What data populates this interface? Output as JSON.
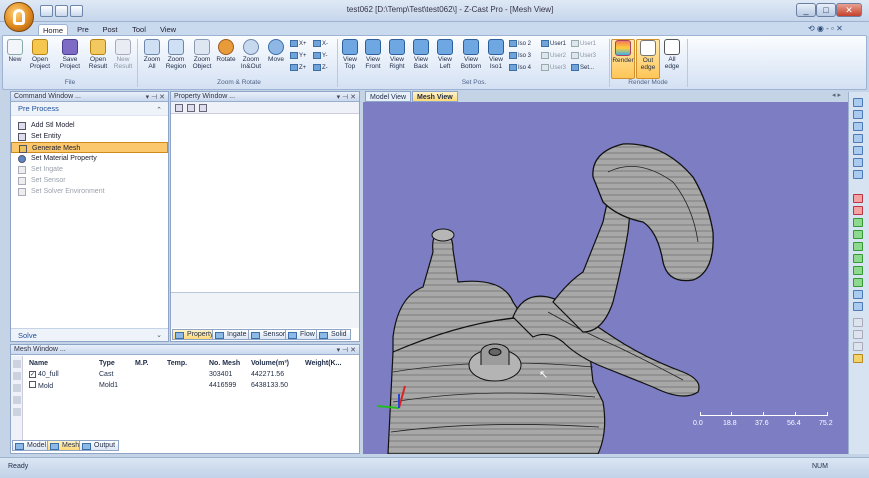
{
  "window": {
    "title": "test062 [D:\\Temp\\Test\\test062\\] - Z-Cast Pro - [Mesh View]",
    "controls": [
      "_",
      "□",
      "✕"
    ]
  },
  "ribbon": {
    "tabs": [
      "Home",
      "Pre",
      "Post",
      "Tool",
      "View"
    ],
    "active_tab": "Home",
    "file_buttons": [
      {
        "label1": "New",
        "label2": "",
        "icon": "new-document-icon"
      },
      {
        "label1": "Open",
        "label2": "Project",
        "icon": "open-folder-icon"
      },
      {
        "label1": "Save",
        "label2": "Project",
        "icon": "save-icon"
      },
      {
        "label1": "Open",
        "label2": "Result",
        "icon": "open-result-icon"
      },
      {
        "label1": "New",
        "label2": "Result",
        "icon": "new-result-icon"
      }
    ],
    "file_group": "File",
    "zoom_buttons": [
      {
        "label1": "Zoom",
        "label2": "All"
      },
      {
        "label1": "Zoom",
        "label2": "Region"
      },
      {
        "label1": "Zoom",
        "label2": "Object"
      },
      {
        "label1": "Rotate",
        "label2": ""
      },
      {
        "label1": "Zoom",
        "label2": "In&Out"
      },
      {
        "label1": "Move",
        "label2": ""
      }
    ],
    "rotate_small": [
      "X+",
      "X-",
      "Y+",
      "Y-",
      "Z+",
      "Z-"
    ],
    "zoom_group": "Zoom & Rotate",
    "view_buttons": [
      {
        "label1": "View",
        "label2": "Top"
      },
      {
        "label1": "View",
        "label2": "Front"
      },
      {
        "label1": "View",
        "label2": "Right"
      },
      {
        "label1": "View",
        "label2": "Back"
      },
      {
        "label1": "View",
        "label2": "Left"
      },
      {
        "label1": "View",
        "label2": "Bottom"
      },
      {
        "label1": "View",
        "label2": "Iso1"
      }
    ],
    "iso_small": [
      "Iso 2",
      "User1",
      "User1",
      "Iso 3",
      "User2",
      "User3",
      "Iso 4",
      "User3",
      "Set..."
    ],
    "setpos_group": "Set Pos.",
    "render_buttons": [
      {
        "label1": "Render",
        "label2": ""
      },
      {
        "label1": "Out",
        "label2": "edge"
      },
      {
        "label1": "All",
        "label2": "edge"
      }
    ],
    "render_group": "Render Mode",
    "right_icons": "⟲ ◉ - ▫ ✕"
  },
  "command_window": {
    "title": "Command Window ...",
    "section": "Pre Process",
    "items": [
      {
        "label": "Add Stl Model",
        "state": "normal"
      },
      {
        "label": "Set Entity",
        "state": "normal"
      },
      {
        "label": "Generate Mesh",
        "state": "selected"
      },
      {
        "label": "Set Material Property",
        "state": "normal"
      },
      {
        "label": "Set Ingate",
        "state": "disabled"
      },
      {
        "label": "Set Sensor",
        "state": "disabled"
      },
      {
        "label": "Set Solver Environment",
        "state": "disabled"
      }
    ],
    "footer": "Solve"
  },
  "property_window": {
    "title": "Property Window ...",
    "tabs": [
      "Property",
      "Ingate",
      "Sensor",
      "Flow",
      "Solid"
    ]
  },
  "mesh_window": {
    "title": "Mesh Window ...",
    "columns": [
      "Name",
      "Type",
      "M.P.",
      "Temp.",
      "No. Mesh",
      "Volume(m³)",
      "Weight(K..."
    ],
    "rows": [
      {
        "checked": true,
        "name": "40_full",
        "type": "Cast",
        "mp": "",
        "temp": "",
        "mesh": "303401",
        "volume": "442271.56",
        "weight": ""
      },
      {
        "checked": false,
        "name": "Mold",
        "type": "Mold1",
        "mp": "",
        "temp": "",
        "mesh": "4416599",
        "volume": "6438133.50",
        "weight": ""
      }
    ],
    "tabs": [
      "Model",
      "Mesh",
      "Output"
    ],
    "active_tab": "Mesh"
  },
  "view_tabs": [
    "Model View",
    "Mesh View"
  ],
  "active_view_tab": "Mesh View",
  "scale_bar": {
    "ticks": [
      "0.0",
      "18.8",
      "37.6",
      "56.4",
      "75.2"
    ]
  },
  "status": {
    "left": "Ready",
    "right": "NUM"
  },
  "colors": {
    "viewport": "#7c7dc3",
    "selected": "#fbc86d",
    "ribbon": "#dfe9f7"
  }
}
